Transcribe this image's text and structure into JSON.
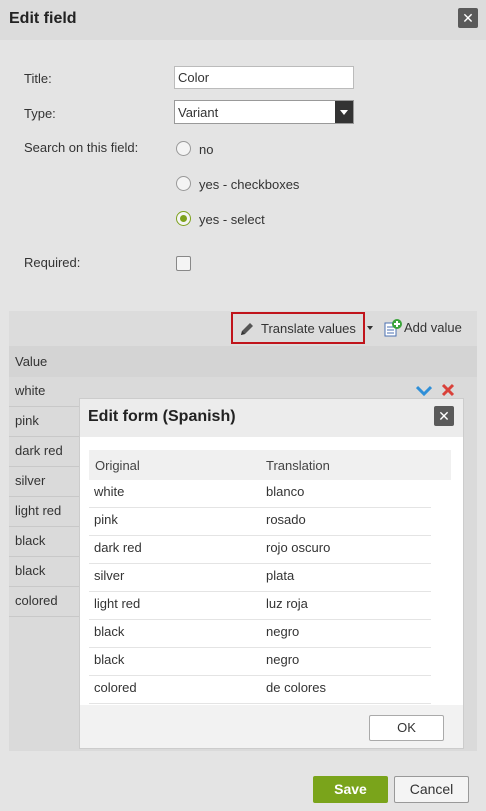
{
  "dialog": {
    "title": "Edit field",
    "close_icon": "close-icon",
    "title_label": "Title:",
    "title_value": "Color",
    "type_label": "Type:",
    "type_value": "Variant",
    "search_label": "Search on this field:",
    "search_options": [
      {
        "label": "no",
        "checked": false
      },
      {
        "label": "yes - checkboxes",
        "checked": false
      },
      {
        "label": "yes - select",
        "checked": true
      }
    ],
    "required_label": "Required:",
    "required_checked": false
  },
  "values": {
    "translate_label": "Translate values",
    "add_value_label": "Add value",
    "column_header": "Value",
    "rows": [
      "white",
      "pink",
      "dark red",
      "silver",
      "light red",
      "black",
      "black",
      "colored"
    ]
  },
  "modal": {
    "title": "Edit form (Spanish)",
    "headers": {
      "original": "Original",
      "translation": "Translation"
    },
    "rows": [
      {
        "original": "white",
        "translation": "blanco"
      },
      {
        "original": "pink",
        "translation": "rosado"
      },
      {
        "original": "dark red",
        "translation": "rojo oscuro"
      },
      {
        "original": "silver",
        "translation": "plata"
      },
      {
        "original": "light red",
        "translation": "luz roja"
      },
      {
        "original": "black",
        "translation": "negro"
      },
      {
        "original": "black",
        "translation": "negro"
      },
      {
        "original": "colored",
        "translation": "de colores"
      }
    ],
    "ok_label": "OK"
  },
  "footer": {
    "save_label": "Save",
    "cancel_label": "Cancel"
  },
  "colors": {
    "accent_green": "#7aa41b",
    "highlight_red": "#c0141b",
    "check_blue": "#2f8fd8",
    "delete_red": "#d9413a"
  }
}
